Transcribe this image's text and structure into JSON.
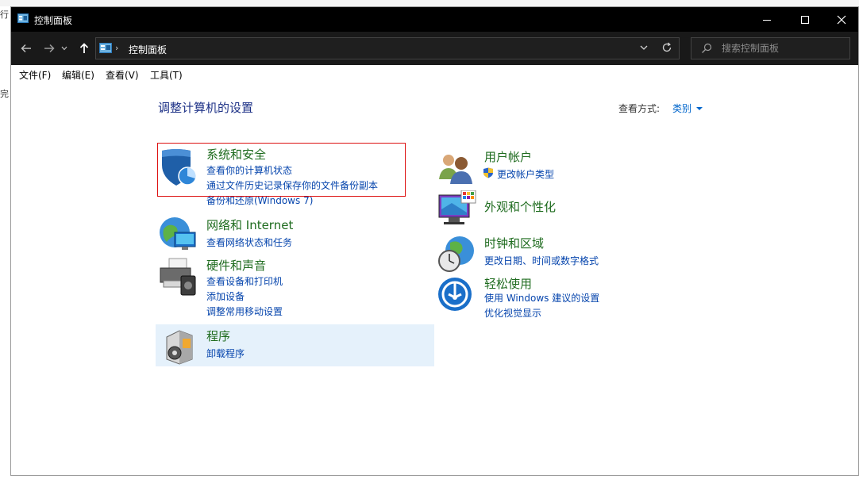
{
  "background": {
    "text_1": "行",
    "text_2": "完"
  },
  "window": {
    "title": "控制面板",
    "controls": {
      "minimize": "—",
      "maximize": "☐",
      "close": "✕"
    }
  },
  "address_bar": {
    "crumbs": [
      "控制面板"
    ]
  },
  "search": {
    "placeholder": "搜索控制面板"
  },
  "menu": [
    "文件(F)",
    "编辑(E)",
    "查看(V)",
    "工具(T)"
  ],
  "content": {
    "heading": "调整计算机的设置",
    "view_by_label": "查看方式:",
    "view_by_value": "类别"
  },
  "categories": [
    {
      "title": "系统和安全",
      "links": [
        "查看你的计算机状态",
        "通过文件历史记录保存你的文件备份副本",
        "备份和还原(Windows 7)"
      ],
      "icon": "shield-icon"
    },
    {
      "title": "网络和 Internet",
      "links": [
        "查看网络状态和任务"
      ],
      "icon": "network-icon"
    },
    {
      "title": "硬件和声音",
      "links": [
        "查看设备和打印机",
        "添加设备",
        "调整常用移动设置"
      ],
      "icon": "printer-icon"
    },
    {
      "title": "程序",
      "links": [
        "卸载程序"
      ],
      "icon": "programs-icon"
    },
    {
      "title": "用户帐户",
      "links": [
        "更改帐户类型"
      ],
      "icon": "users-icon"
    },
    {
      "title": "外观和个性化",
      "links": [],
      "icon": "monitor-icon"
    },
    {
      "title": "时钟和区域",
      "links": [
        "更改日期、时间或数字格式"
      ],
      "icon": "clock-globe-icon"
    },
    {
      "title": "轻松使用",
      "links": [
        "使用 Windows 建议的设置",
        "优化视觉显示"
      ],
      "icon": "ease-of-access-icon"
    }
  ],
  "colors": {
    "accent": "#0066cc",
    "category_title": "#1e6b1e",
    "link": "#0645ad",
    "highlight_border": "#dd1111",
    "hover_bg": "#e5f1fb"
  }
}
